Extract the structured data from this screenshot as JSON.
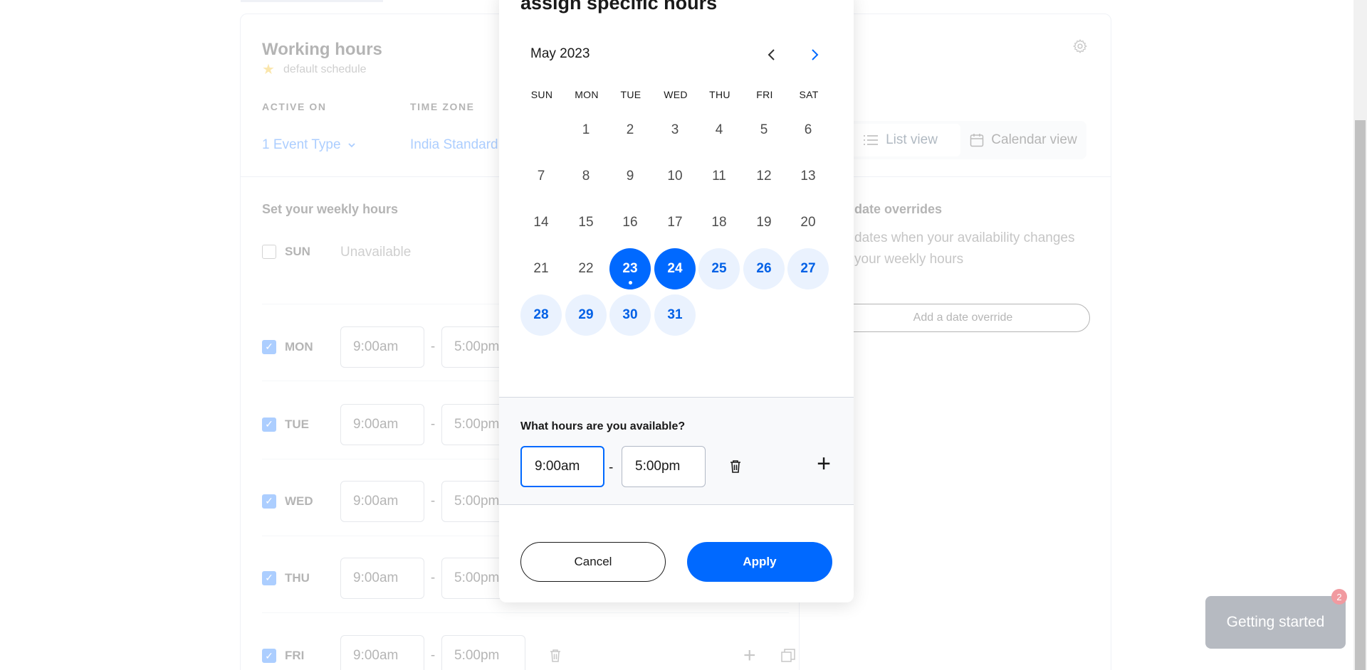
{
  "background": {
    "working_hours_title": "Working hours",
    "default_schedule": "default schedule",
    "active_on_label": "ACTIVE ON",
    "active_on_value": "1 Event Type",
    "time_zone_label": "TIME ZONE",
    "time_zone_value": "India Standard",
    "view_toggle": {
      "list": "List view",
      "calendar": "Calendar view"
    },
    "weekly_title": "Set your weekly hours",
    "days": [
      {
        "name": "SUN",
        "checked": false,
        "unavailable": "Unavailable"
      },
      {
        "name": "MON",
        "checked": true,
        "start": "9:00am",
        "end": "5:00pm"
      },
      {
        "name": "TUE",
        "checked": true,
        "start": "9:00am",
        "end": "5:00pm"
      },
      {
        "name": "WED",
        "checked": true,
        "start": "9:00am",
        "end": "5:00pm"
      },
      {
        "name": "THU",
        "checked": true,
        "start": "9:00am",
        "end": "5:00pm"
      },
      {
        "name": "FRI",
        "checked": true,
        "start": "9:00am",
        "end": "5:00pm"
      }
    ],
    "overrides_title": "date overrides",
    "overrides_text_1": "dates when your availability changes",
    "overrides_text_2": "your weekly hours",
    "add_override": "Add a date override"
  },
  "modal": {
    "title": "assign specific hours",
    "month": "May 2023",
    "weekdays": [
      "SUN",
      "MON",
      "TUE",
      "WED",
      "THU",
      "FRI",
      "SAT"
    ],
    "days": {
      "1": "1",
      "2": "2",
      "3": "3",
      "4": "4",
      "5": "5",
      "6": "6",
      "7": "7",
      "8": "8",
      "9": "9",
      "10": "10",
      "11": "11",
      "12": "12",
      "13": "13",
      "14": "14",
      "15": "15",
      "16": "16",
      "17": "17",
      "18": "18",
      "19": "19",
      "20": "20",
      "21": "21",
      "22": "22",
      "23": "23",
      "24": "24",
      "25": "25",
      "26": "26",
      "27": "27",
      "28": "28",
      "29": "29",
      "30": "30",
      "31": "31"
    },
    "selected_dates": [
      23,
      24
    ],
    "available_dates": [
      25,
      26,
      27,
      28,
      29,
      30,
      31
    ],
    "today": 23,
    "hours_label": "What hours are you available?",
    "start_time": "9:00am",
    "end_time": "5:00pm",
    "dash": "-",
    "cancel": "Cancel",
    "apply": "Apply"
  },
  "widget": {
    "label": "Getting started",
    "badge": "2"
  },
  "colors": {
    "accent": "#0069ff",
    "accent_light": "#eaf2fe",
    "border": "#cfd6e4"
  }
}
